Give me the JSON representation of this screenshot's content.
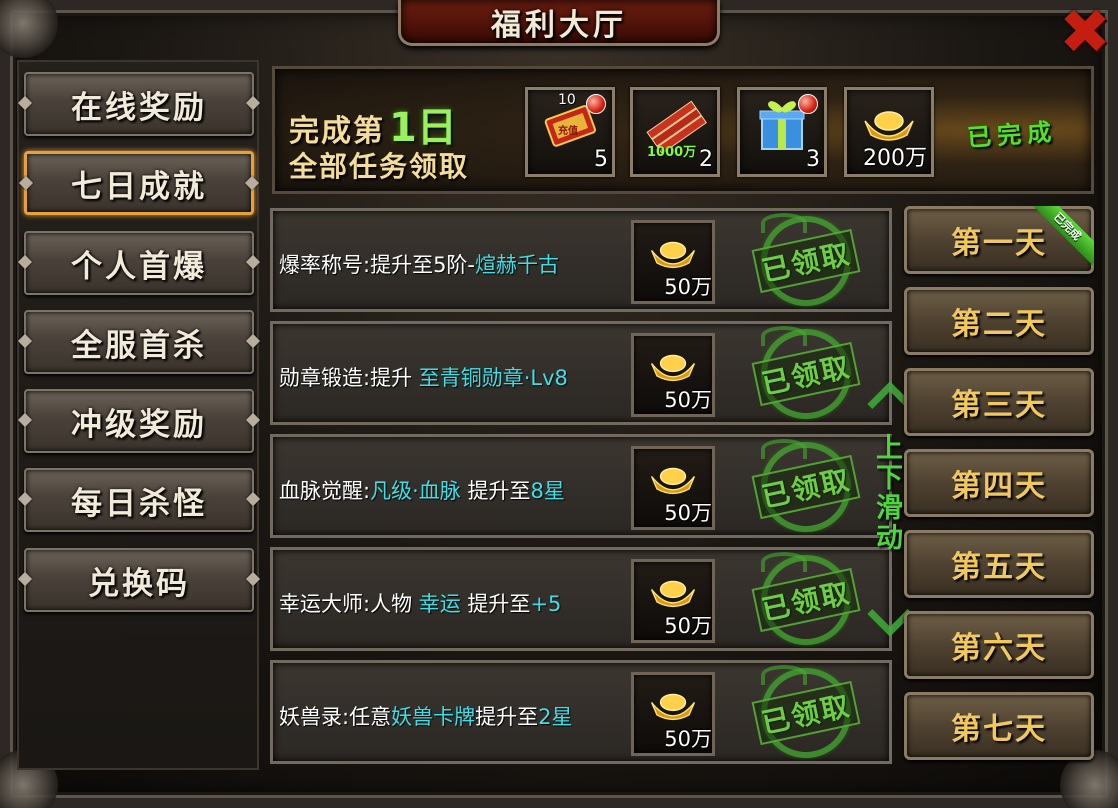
{
  "window": {
    "title": "福利大厅",
    "close_icon": "✖"
  },
  "sidebar": {
    "items": [
      {
        "label": "在线奖励"
      },
      {
        "label": "七日成就",
        "active": true
      },
      {
        "label": "个人首爆"
      },
      {
        "label": "全服首杀"
      },
      {
        "label": "冲级奖励"
      },
      {
        "label": "每日杀怪"
      },
      {
        "label": "兑换码"
      }
    ]
  },
  "banner": {
    "line1_prefix": "完成第",
    "line1_day": "1日",
    "line2": "全部任务领取",
    "rewards": [
      {
        "icon": "recharge-card-icon",
        "qty": "5",
        "badge": "10",
        "card_label": "充值"
      },
      {
        "icon": "firecracker-icon",
        "qty": "2",
        "tag": "1000万"
      },
      {
        "icon": "gift-box-icon",
        "qty": "3"
      },
      {
        "icon": "gold-ingot-icon",
        "qty": "200万"
      }
    ],
    "status": "已完成"
  },
  "tasks": [
    {
      "label": "爆率称号:提升至5阶-",
      "highlight": "煊赫千古",
      "suffix": "",
      "reward_qty": "50万",
      "stamp": "已领取"
    },
    {
      "label": "勋章锻造:提升 ",
      "highlight": "至青铜勋章·Lv8",
      "suffix": "",
      "reward_qty": "50万",
      "stamp": "已领取"
    },
    {
      "label": "血脉觉醒:",
      "highlight": "凡级·血脉",
      "suffix": " 提升至",
      "highlight2": "8星",
      "reward_qty": "50万",
      "stamp": "已领取"
    },
    {
      "label": "幸运大师:人物 ",
      "highlight": "幸运",
      "suffix": " 提升至",
      "highlight2": "+5",
      "reward_qty": "50万",
      "stamp": "已领取"
    },
    {
      "label": "妖兽录:任意",
      "highlight": "妖兽卡牌",
      "suffix": "提升至",
      "highlight2": "2星",
      "reward_qty": "50万",
      "stamp": "已领取"
    }
  ],
  "scroll_hint": "上下滑动",
  "days": [
    {
      "label": "第一天",
      "badge": "已完成"
    },
    {
      "label": "第二天"
    },
    {
      "label": "第三天"
    },
    {
      "label": "第四天"
    },
    {
      "label": "第五天"
    },
    {
      "label": "第六天"
    },
    {
      "label": "第七天"
    }
  ],
  "colors": {
    "highlight": "#3ee0e8",
    "active_border": "#e8a13a",
    "stamp_green": "#6fcc45"
  }
}
